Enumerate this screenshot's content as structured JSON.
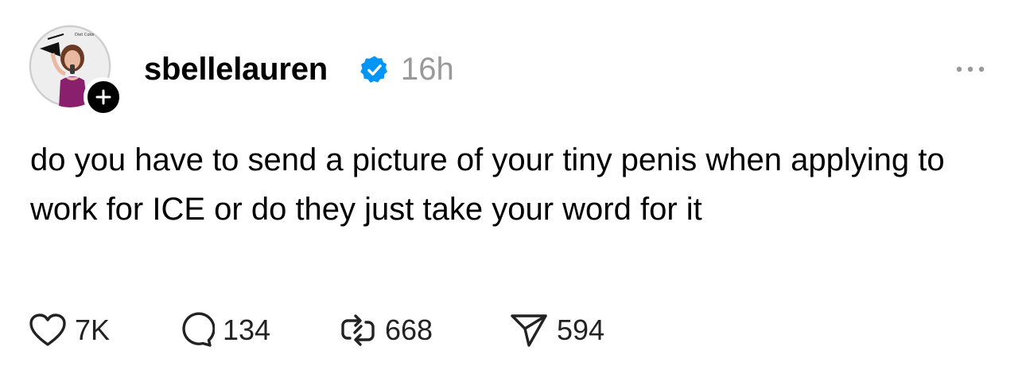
{
  "post": {
    "username": "sbellelauren",
    "timestamp": "16h",
    "text": "do you have to send a picture of your tiny penis when applying to work for ICE or do they just take your word for it",
    "avatar_caption": "Diet Coke"
  },
  "actions": {
    "likes": "7K",
    "replies": "134",
    "reposts": "668",
    "shares": "594"
  },
  "icons": {
    "follow": "plus-icon",
    "verified": "verified-badge-icon",
    "more": "more-icon",
    "like": "heart-icon",
    "reply": "reply-bubble-icon",
    "repost": "repost-icon",
    "share": "send-icon"
  },
  "colors": {
    "verified_blue": "#0095F6",
    "timestamp_gray": "#999999",
    "text": "#000000"
  }
}
